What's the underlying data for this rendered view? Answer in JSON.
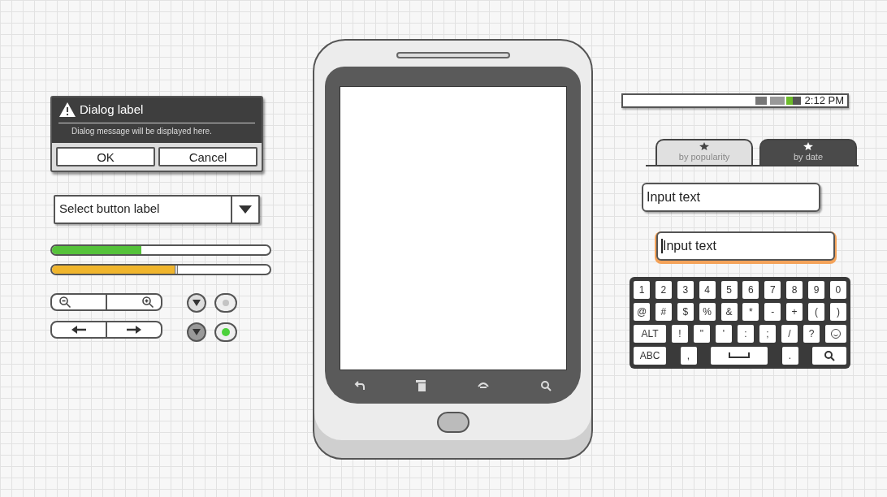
{
  "dialog": {
    "title": "Dialog label",
    "message": "Dialog message will be displayed here.",
    "buttons": [
      "OK",
      "Cancel"
    ]
  },
  "select": {
    "label": "Select button label"
  },
  "bars": [
    {
      "kind": "progress",
      "level": 0.41,
      "color": "#55c23a"
    },
    {
      "kind": "slider",
      "level": 0.57,
      "color": "#f0b52c"
    }
  ],
  "spinners": [
    {
      "pressed": false
    },
    {
      "pressed": true
    }
  ],
  "radios": [
    {
      "selected": false
    },
    {
      "selected": true
    }
  ],
  "status_bar": {
    "time": "2:12 PM"
  },
  "tabs": [
    {
      "label": "by popularity",
      "selected": false
    },
    {
      "label": "by date",
      "selected": true
    }
  ],
  "inputs": [
    {
      "value": "Input text",
      "focused": false
    },
    {
      "value": "Input text",
      "focused": true
    }
  ],
  "keyboard": {
    "rows": [
      [
        {
          "kind": "char",
          "label": "1"
        },
        {
          "kind": "char",
          "label": "2"
        },
        {
          "kind": "char",
          "label": "3"
        },
        {
          "kind": "char",
          "label": "4"
        },
        {
          "kind": "char",
          "label": "5"
        },
        {
          "kind": "char",
          "label": "6"
        },
        {
          "kind": "char",
          "label": "7"
        },
        {
          "kind": "char",
          "label": "8"
        },
        {
          "kind": "char",
          "label": "9"
        },
        {
          "kind": "char",
          "label": "0"
        }
      ],
      [
        {
          "kind": "char",
          "label": "@"
        },
        {
          "kind": "char",
          "label": "#"
        },
        {
          "kind": "char",
          "label": "$"
        },
        {
          "kind": "char",
          "label": "%"
        },
        {
          "kind": "char",
          "label": "&"
        },
        {
          "kind": "char",
          "label": "*"
        },
        {
          "kind": "char",
          "label": "-"
        },
        {
          "kind": "char",
          "label": "+"
        },
        {
          "kind": "char",
          "label": "("
        },
        {
          "kind": "char",
          "label": ")"
        }
      ],
      [
        {
          "kind": "wide",
          "label": "ALT"
        },
        {
          "kind": "char",
          "label": "!"
        },
        {
          "kind": "char",
          "label": "\""
        },
        {
          "kind": "char",
          "label": "'"
        },
        {
          "kind": "char",
          "label": ":"
        },
        {
          "kind": "char",
          "label": ";"
        },
        {
          "kind": "char",
          "label": "/"
        },
        {
          "kind": "char",
          "label": "?"
        },
        {
          "kind": "emoji"
        }
      ],
      [
        {
          "kind": "wide",
          "label": "ABC"
        },
        {
          "kind": "char",
          "label": ","
        },
        {
          "kind": "space"
        },
        {
          "kind": "char",
          "label": "."
        },
        {
          "kind": "search"
        }
      ]
    ]
  }
}
